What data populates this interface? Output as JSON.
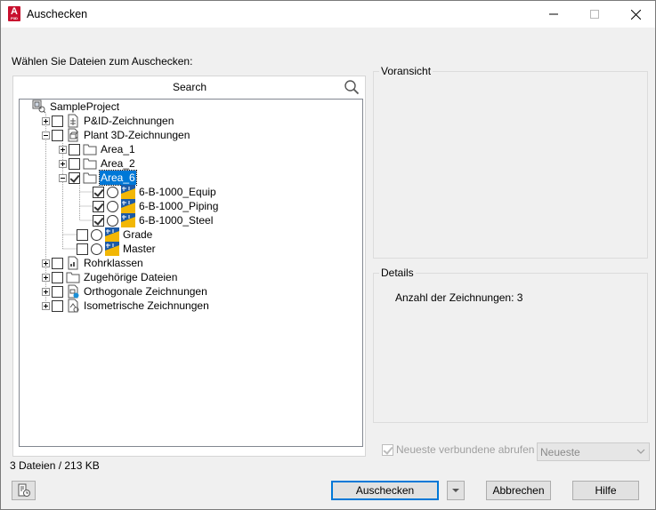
{
  "window": {
    "title": "Auschecken"
  },
  "prompt": "Wählen Sie Dateien zum Auschecken:",
  "search": {
    "label": "Search"
  },
  "tree": {
    "root": "SampleProject",
    "pid": "P&ID-Zeichnungen",
    "plant3d": "Plant 3D-Zeichnungen",
    "area1": "Area_1",
    "area2": "Area_2",
    "area6": "Area_6",
    "equip": "6-B-1000_Equip",
    "piping": "6-B-1000_Piping",
    "steel": "6-B-1000_Steel",
    "grade": "Grade",
    "master": "Master",
    "rohr": "Rohrklassen",
    "zugeh": "Zugehörige Dateien",
    "ortho": "Orthogonale Zeichnungen",
    "iso": "Isometrische Zeichnungen"
  },
  "preview": {
    "title": "Voransicht"
  },
  "details": {
    "title": "Details",
    "text": "Anzahl der Zeichnungen: 3"
  },
  "recent": {
    "label": "Neueste verbundene abrufen",
    "checked": true,
    "dropdown_value": "Neueste"
  },
  "status": "3 Dateien / 213 KB",
  "buttons": {
    "checkout": "Auschecken",
    "cancel": "Abbrechen",
    "help": "Hilfe"
  },
  "colors": {
    "accent": "#0078d7",
    "app_icon": "#c8102e",
    "dwg_blue": "#1c5aa6",
    "dwg_yellow": "#f2b705"
  }
}
